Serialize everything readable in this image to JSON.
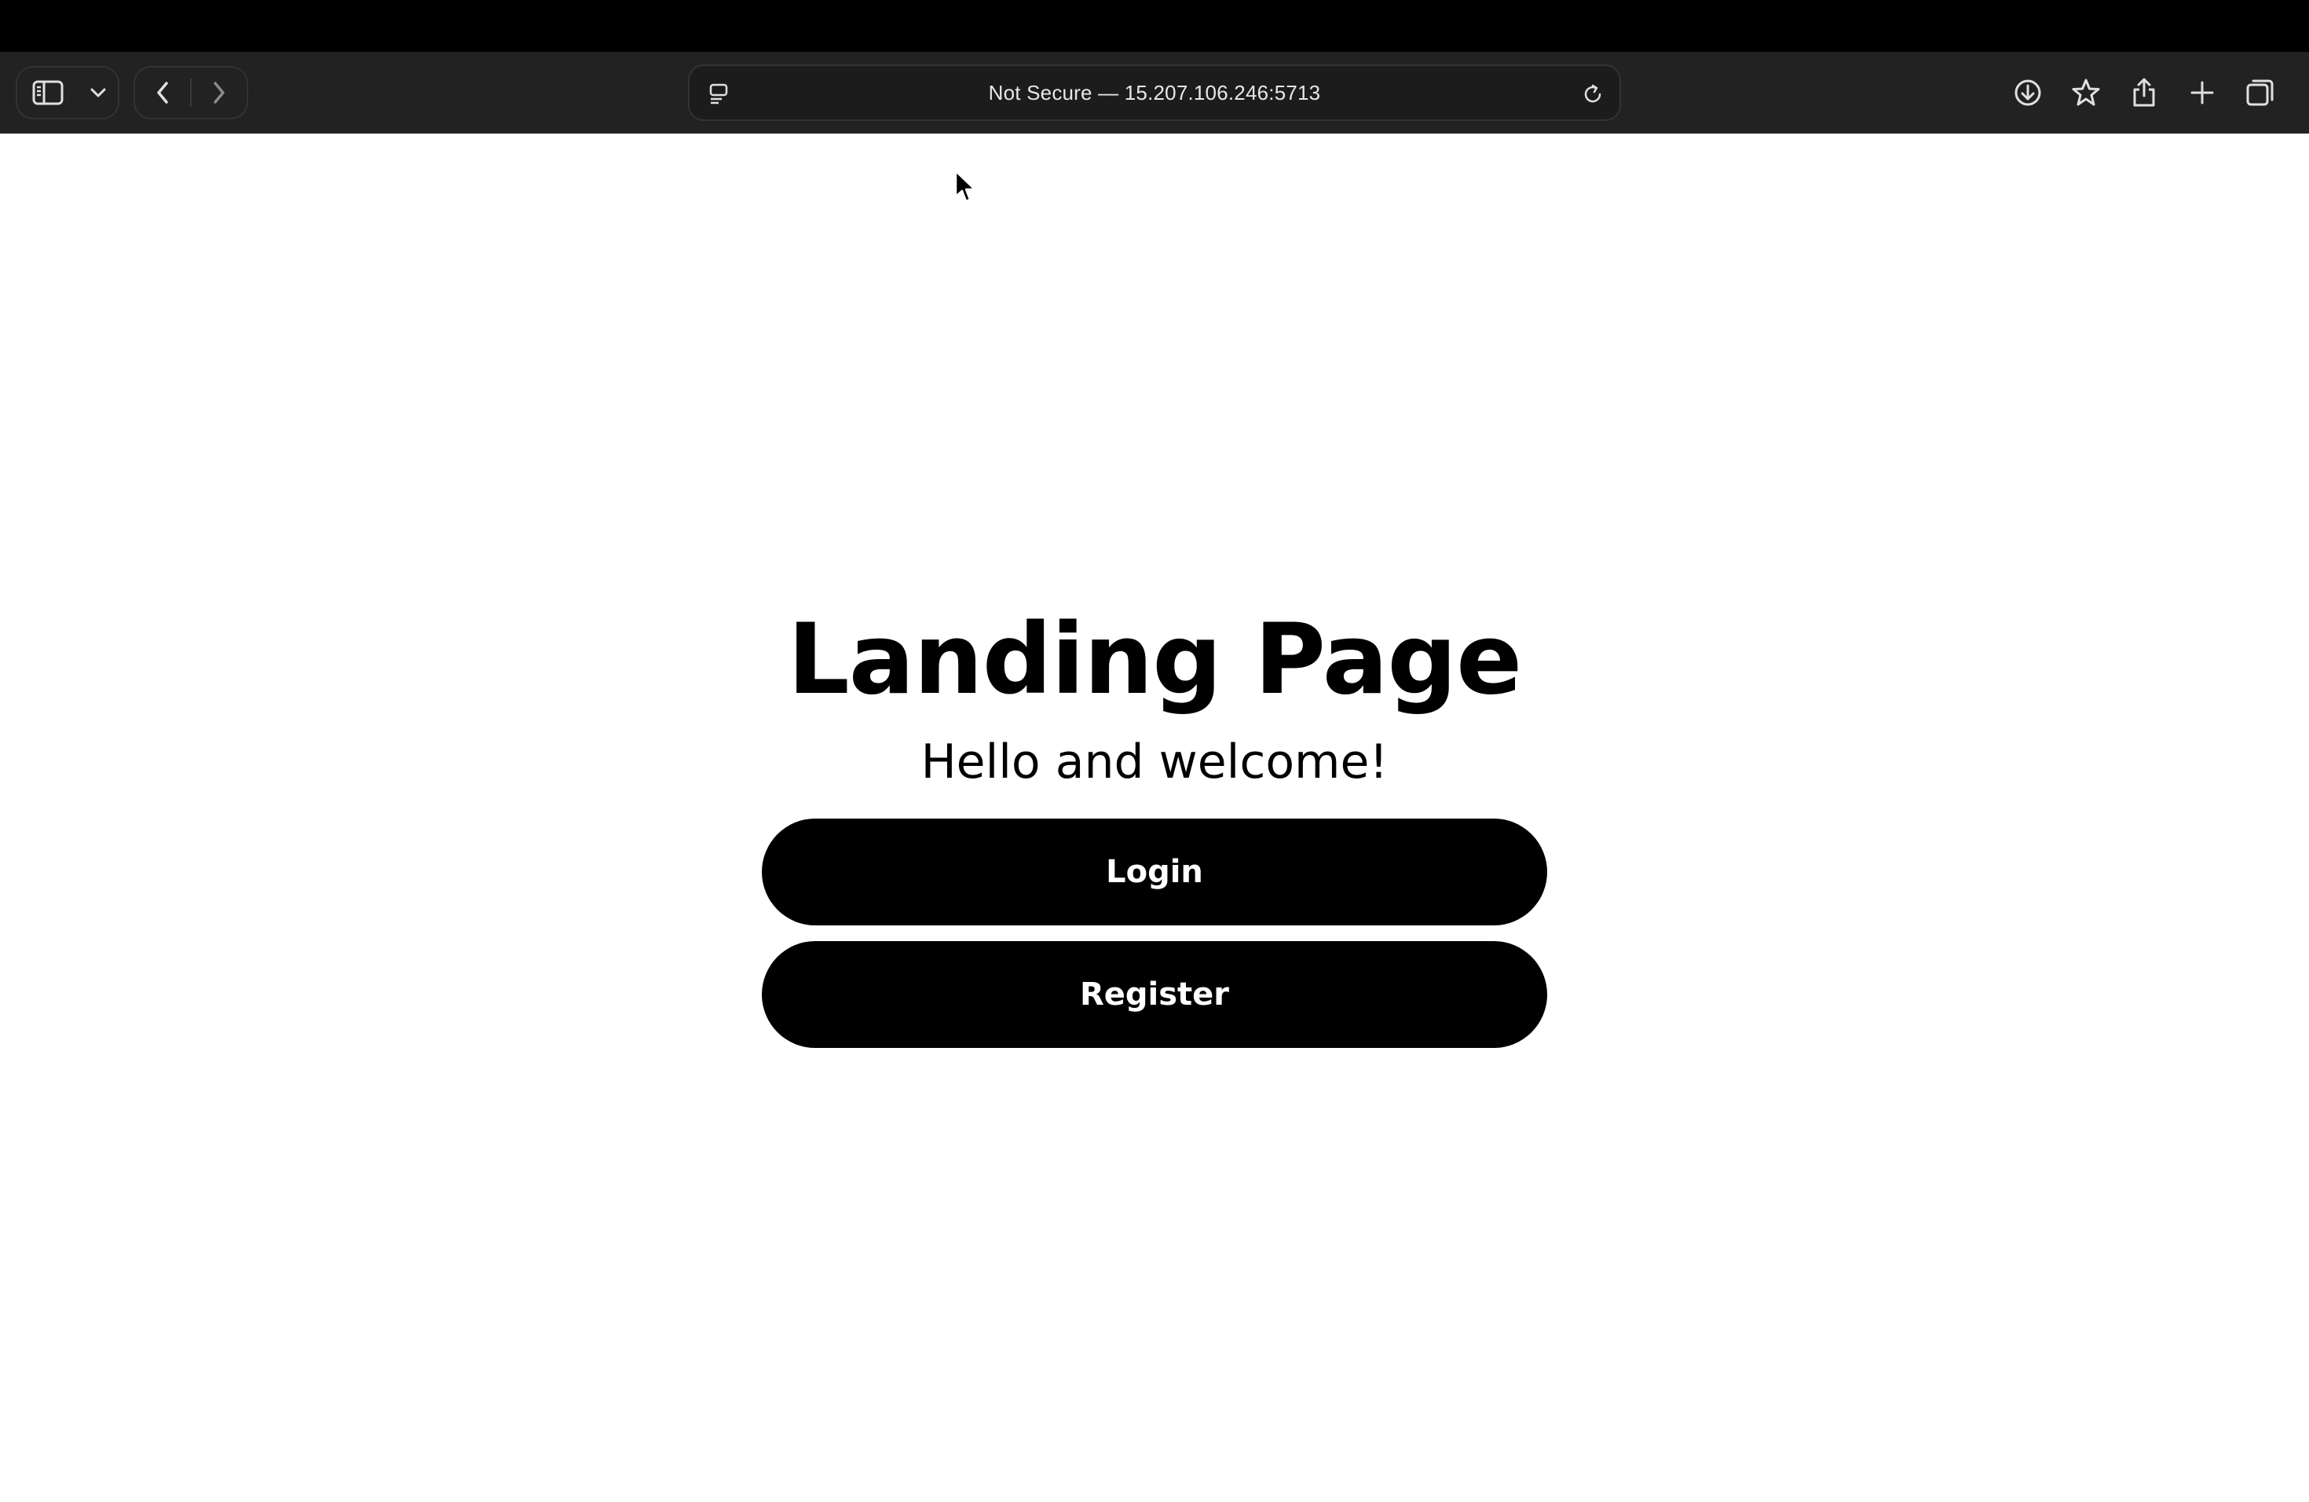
{
  "browser": {
    "address_bar": {
      "text": "Not Secure — 15.207.106.246:5713"
    },
    "toolbar_icons": {
      "sidebar": "sidebar-icon",
      "sidebar_menu": "chevron-down-icon",
      "back": "chevron-left-icon",
      "forward": "chevron-right-icon",
      "page_settings": "page-settings-icon",
      "reload": "reload-icon",
      "downloads": "download-icon",
      "bookmark": "star-icon",
      "share": "share-icon",
      "new_tab": "plus-icon",
      "tab_overview": "tabs-overview-icon"
    },
    "colors": {
      "chrome": "#222222",
      "address_bg": "#1c1c1c",
      "icon": "#e0e0e0"
    }
  },
  "page": {
    "title": "Landing Page",
    "subtitle": "Hello and welcome!",
    "buttons": {
      "login": "Login",
      "register": "Register"
    },
    "colors": {
      "background": "#ffffff",
      "text": "#000000",
      "button_bg": "#000000",
      "button_text": "#ffffff"
    }
  }
}
